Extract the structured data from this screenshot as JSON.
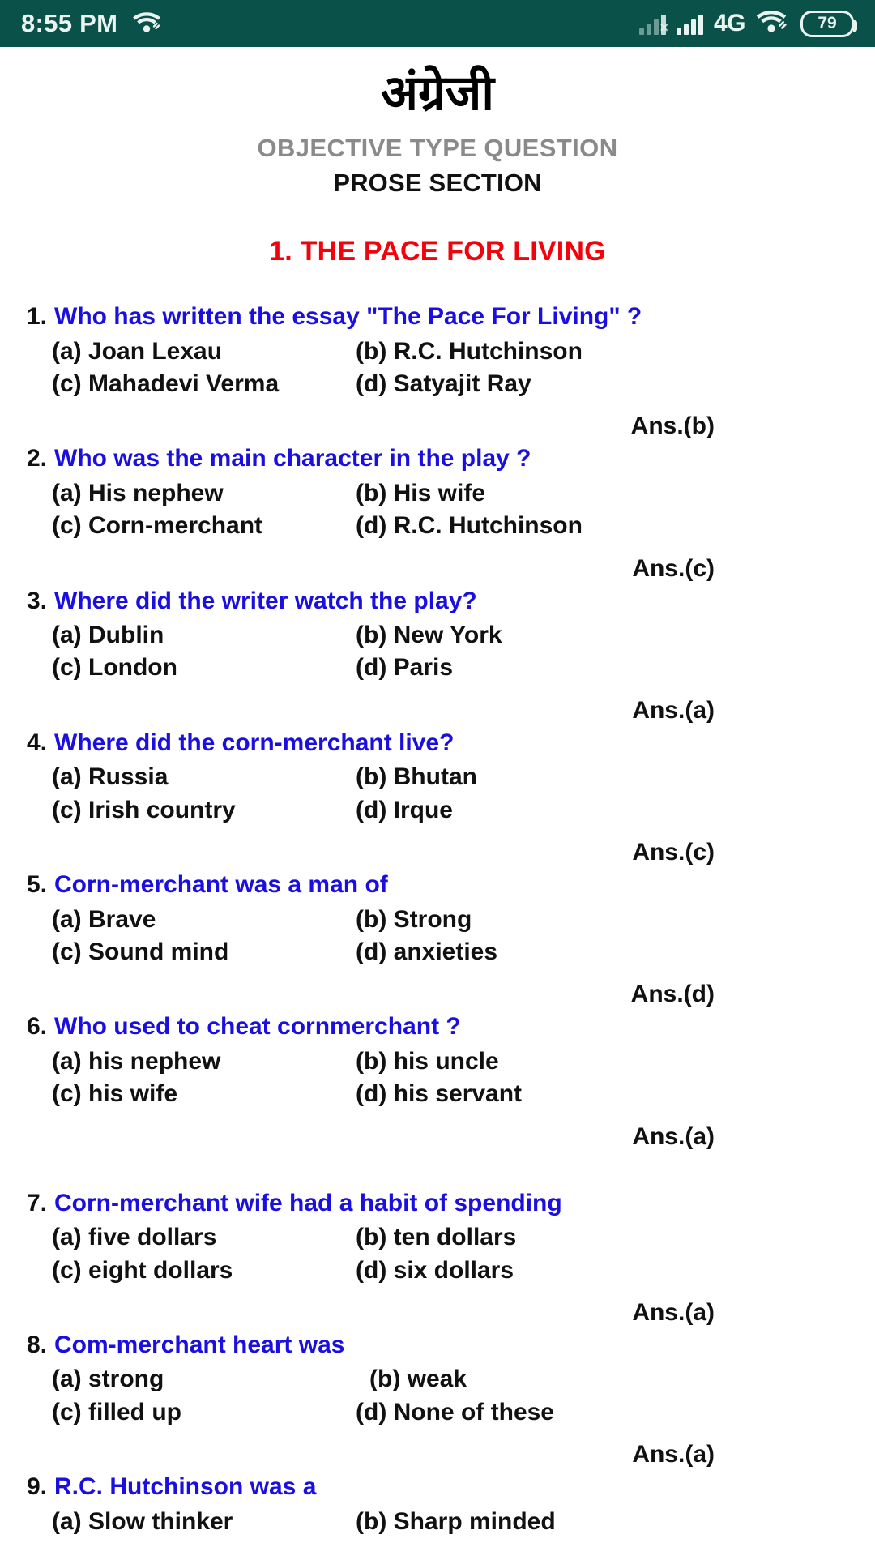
{
  "statusbar": {
    "time": "8:55 PM",
    "wifi_icon": "wifi-icon",
    "wifi_link_icon": "wifi-link-icon",
    "sim_none_icon": "signal-no-sim-icon",
    "signal_icon": "signal-bars-icon",
    "network_type": "4G",
    "battery_level": "79",
    "background_color": "#0a5149"
  },
  "header": {
    "doc_title": "अंग्रेजी",
    "subtitle": "OBJECTIVE TYPE QUESTION",
    "section_label": "PROSE SECTION",
    "chapter_title": "1. THE PACE FOR LIVING",
    "chapter_color": "#f4020b",
    "question_color": "#1a0fe0"
  },
  "questions": [
    {
      "num": "1.",
      "text": "Who has written the essay \"The Pace For Living\" ?",
      "a": "(a) Joan Lexau",
      "b": "(b) R.C. Hutchinson",
      "c": "(c) Mahadevi Verma",
      "d": "(d) Satyajit Ray",
      "answer": "Ans.(b)"
    },
    {
      "num": "2.",
      "text": "Who was the main character in the play ?",
      "a": "(a) His nephew",
      "b": "(b) His wife",
      "c": "(c) Corn-merchant",
      "d": "(d) R.C. Hutchinson",
      "answer": "Ans.(c)"
    },
    {
      "num": "3.",
      "text": "Where did the writer watch the play?",
      "a": "(a) Dublin",
      "b": "(b) New York",
      "c": "(c) London",
      "d": "(d) Paris",
      "answer": "Ans.(a)"
    },
    {
      "num": "4.",
      "text": "Where did the corn-merchant live?",
      "a": "(a) Russia",
      "b": "(b) Bhutan",
      "c": "(c) Irish country",
      "d": "(d) Irque",
      "answer": "Ans.(c)"
    },
    {
      "num": "5.",
      "text": "Corn-merchant was a man of",
      "a": "(a) Brave",
      "b": "(b) Strong",
      "c": "(c) Sound mind",
      "d": "(d) anxieties",
      "answer": "Ans.(d)"
    },
    {
      "num": "6.",
      "text": "Who used to cheat cornmerchant ?",
      "a": "(a) his nephew",
      "b": "(b) his uncle",
      "c": "(c) his wife",
      "d": "(d) his servant",
      "answer": "Ans.(a)"
    },
    {
      "num": "7.",
      "text": "Corn-merchant wife had a habit of spending",
      "a": "(a) five dollars",
      "b": "(b) ten dollars",
      "c": "(c) eight dollars",
      "d": "(d) six dollars",
      "answer": "Ans.(a)"
    },
    {
      "num": "8.",
      "text": "Com-merchant heart was",
      "a": "(a) strong",
      "b": "(b) weak",
      "c": "(c) filled up",
      "d": "(d) None of these",
      "answer": "Ans.(a)"
    },
    {
      "num": "9.",
      "text": "R.C. Hutchinson was a",
      "a": "(a) Slow thinker",
      "b": "(b) Sharp minded",
      "c": "",
      "d": "",
      "answer": ""
    }
  ]
}
